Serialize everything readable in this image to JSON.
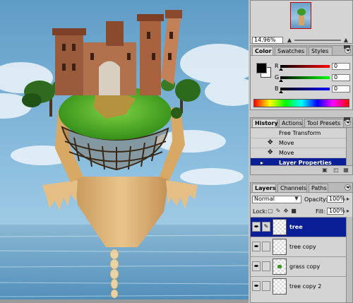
{
  "colors": {
    "accent": "#0a1f96",
    "panel": "#d4d4d4"
  },
  "navigator": {
    "zoom": "14.96%"
  },
  "color_panel": {
    "tabs": [
      "Color",
      "Swatches",
      "Styles"
    ],
    "channels": [
      {
        "label": "R",
        "value": "0"
      },
      {
        "label": "G",
        "value": "0"
      },
      {
        "label": "B",
        "value": "0"
      }
    ]
  },
  "history_panel": {
    "tabs": [
      "History",
      "Actions",
      "Tool Presets"
    ],
    "items": [
      "Free Transform",
      "Move",
      "Move",
      "Layer Properties"
    ],
    "buttons": [
      "new-snapshot-icon",
      "new-document-icon",
      "trash-icon"
    ]
  },
  "layers_panel": {
    "tabs": [
      "Layers",
      "Channels",
      "Paths"
    ],
    "blend_mode": "Normal",
    "opacity_label": "Opacity:",
    "opacity": "100%",
    "lock_label": "Lock:",
    "fill_label": "Fill:",
    "fill": "100%",
    "layers": [
      "tree",
      "tree copy",
      "grass copy",
      "tree copy 2"
    ]
  }
}
